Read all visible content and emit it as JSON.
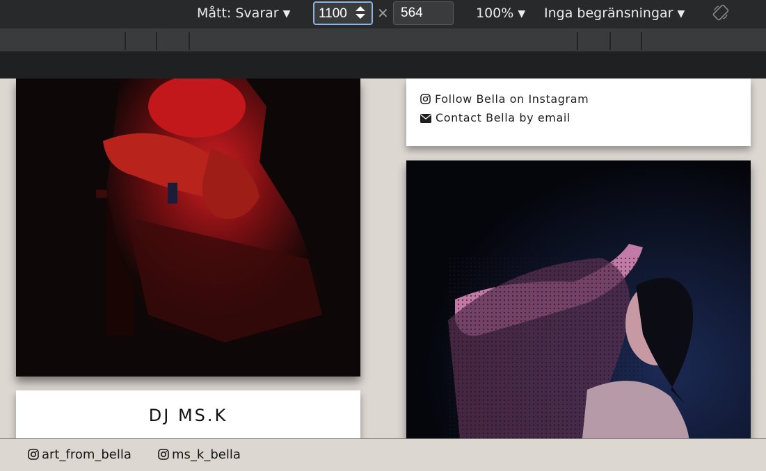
{
  "toolbar": {
    "device_label": "Mått: Svarar",
    "width_value": "1100",
    "height_value": "564",
    "zoom_label": "100%",
    "throttle_label": "Inga begränsningar"
  },
  "page": {
    "right_card": {
      "instagram_link": "Follow Bella on Instagram",
      "email_link": "Contact Bella by email"
    },
    "left_card": {
      "title": "DJ MS.K"
    }
  },
  "footer": {
    "links": [
      "art_from_bella",
      "ms_k_bella"
    ]
  },
  "colors": {
    "toolbar_bg": "#28292b",
    "page_bg": "#ddd7d2",
    "accent_focus": "#8fb2e0"
  },
  "icons": [
    "dropdown-caret-icon",
    "stepper-icon",
    "rotate-icon",
    "instagram-icon",
    "envelope-icon"
  ]
}
